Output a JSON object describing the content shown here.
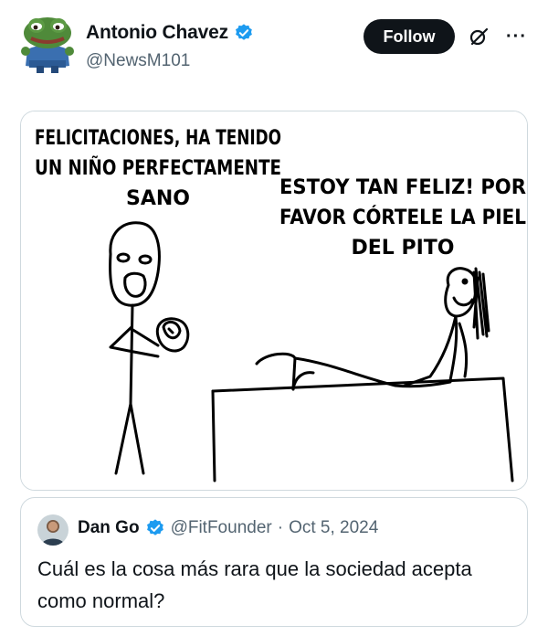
{
  "post": {
    "author_name": "Antonio Chavez",
    "author_handle": "@NewsM101",
    "follow_label": "Follow",
    "more_glyph": "···"
  },
  "comic": {
    "left_caption": [
      "FELICITACIONES, HA TENIDO",
      "UN NIÑO PERFECTAMENTE",
      "SANO"
    ],
    "right_caption": [
      "ESTOY TAN FELIZ! POR",
      "FAVOR CÓRTELE LA PIEL",
      "DEL PITO"
    ]
  },
  "quoted": {
    "name": "Dan Go",
    "handle": "@FitFounder",
    "separator": "·",
    "date": "Oct 5, 2024",
    "text": "Cuál es la cosa más rara que la sociedad acepta como normal?"
  },
  "colors": {
    "verified_blue": "#1d9bf0",
    "text_primary": "#0f1419",
    "text_secondary": "#536471",
    "follow_bg": "#0f1419"
  },
  "icons": [
    "verified-badge-icon",
    "grok-icon",
    "more-icon"
  ]
}
